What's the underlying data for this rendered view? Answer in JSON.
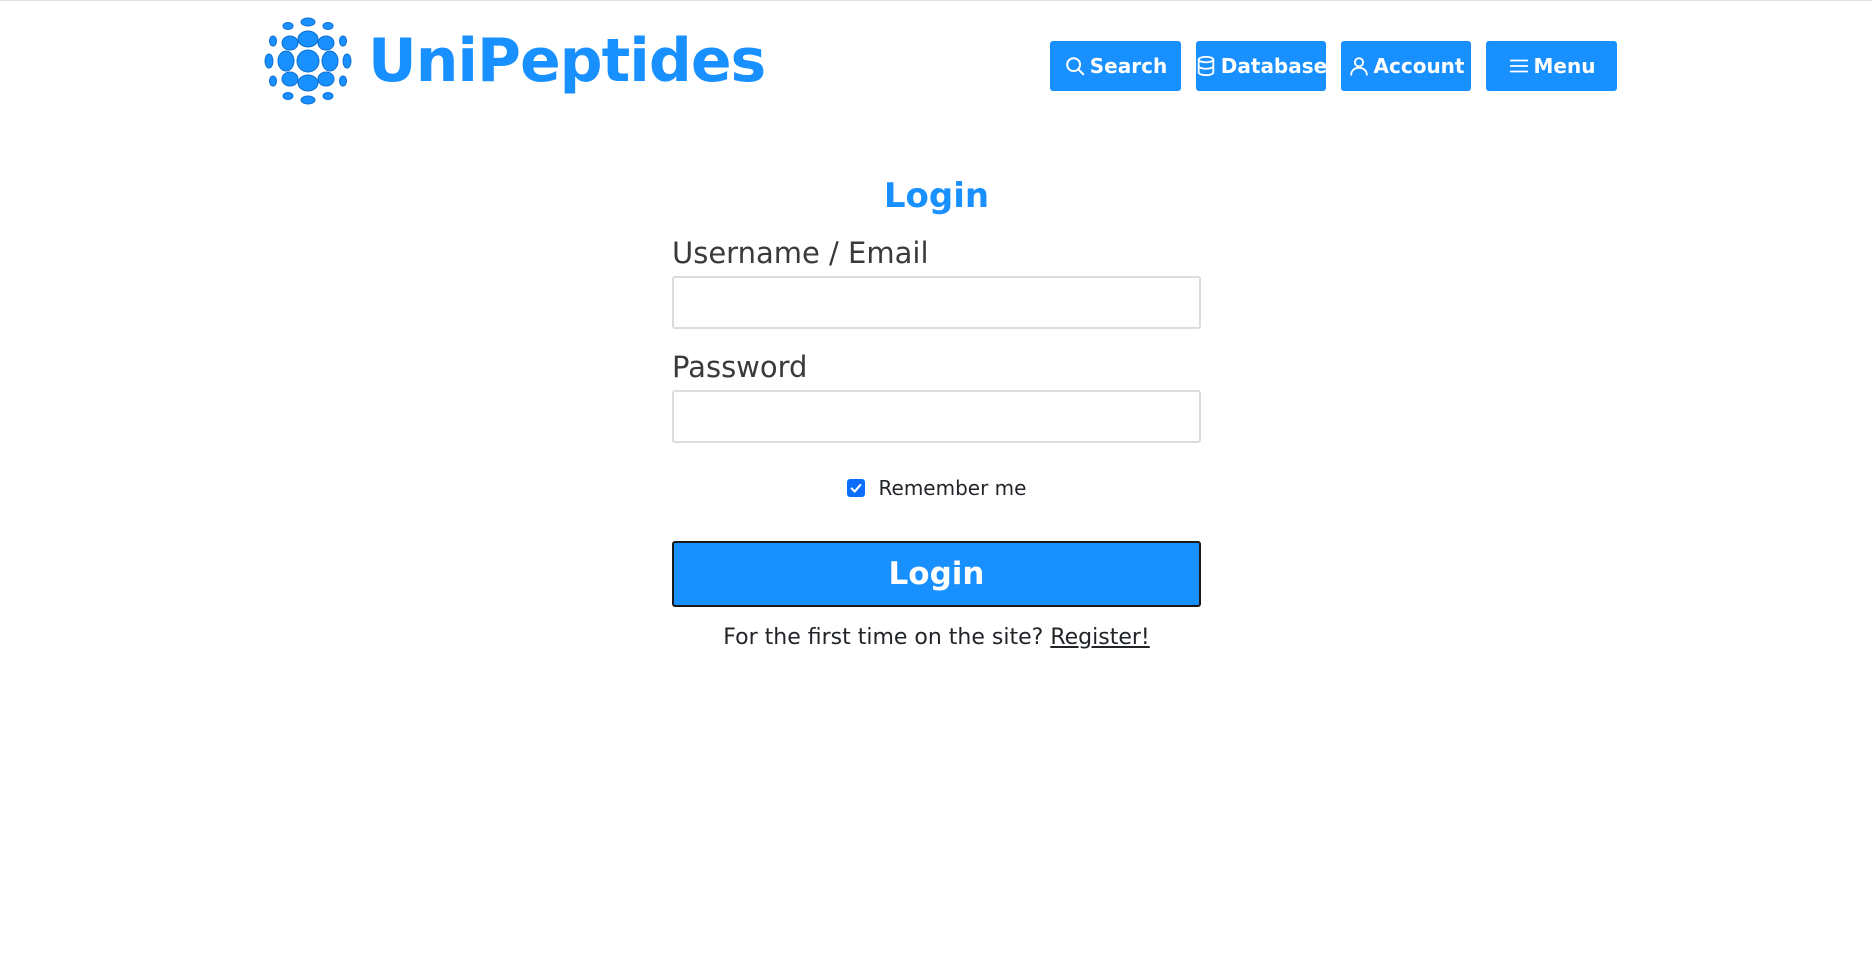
{
  "brand": {
    "name": "UniPeptides",
    "logo_icon": "molecule-sphere-icon",
    "color": "#1890ff"
  },
  "nav": {
    "search": {
      "label": "Search",
      "icon": "search-icon"
    },
    "database": {
      "label": "Database",
      "icon": "database-icon"
    },
    "account": {
      "label": "Account",
      "icon": "user-icon"
    },
    "menu": {
      "label": "Menu",
      "icon": "hamburger-icon"
    }
  },
  "form": {
    "title": "Login",
    "username_label": "Username / Email",
    "username_value": "",
    "password_label": "Password",
    "password_value": "",
    "remember_label": "Remember me",
    "remember_checked": true,
    "submit_label": "Login",
    "register_prompt": "For the first time on the site?",
    "register_link": "Register!"
  },
  "colors": {
    "accent": "#1890ff",
    "checkbox": "#0d6efd"
  }
}
